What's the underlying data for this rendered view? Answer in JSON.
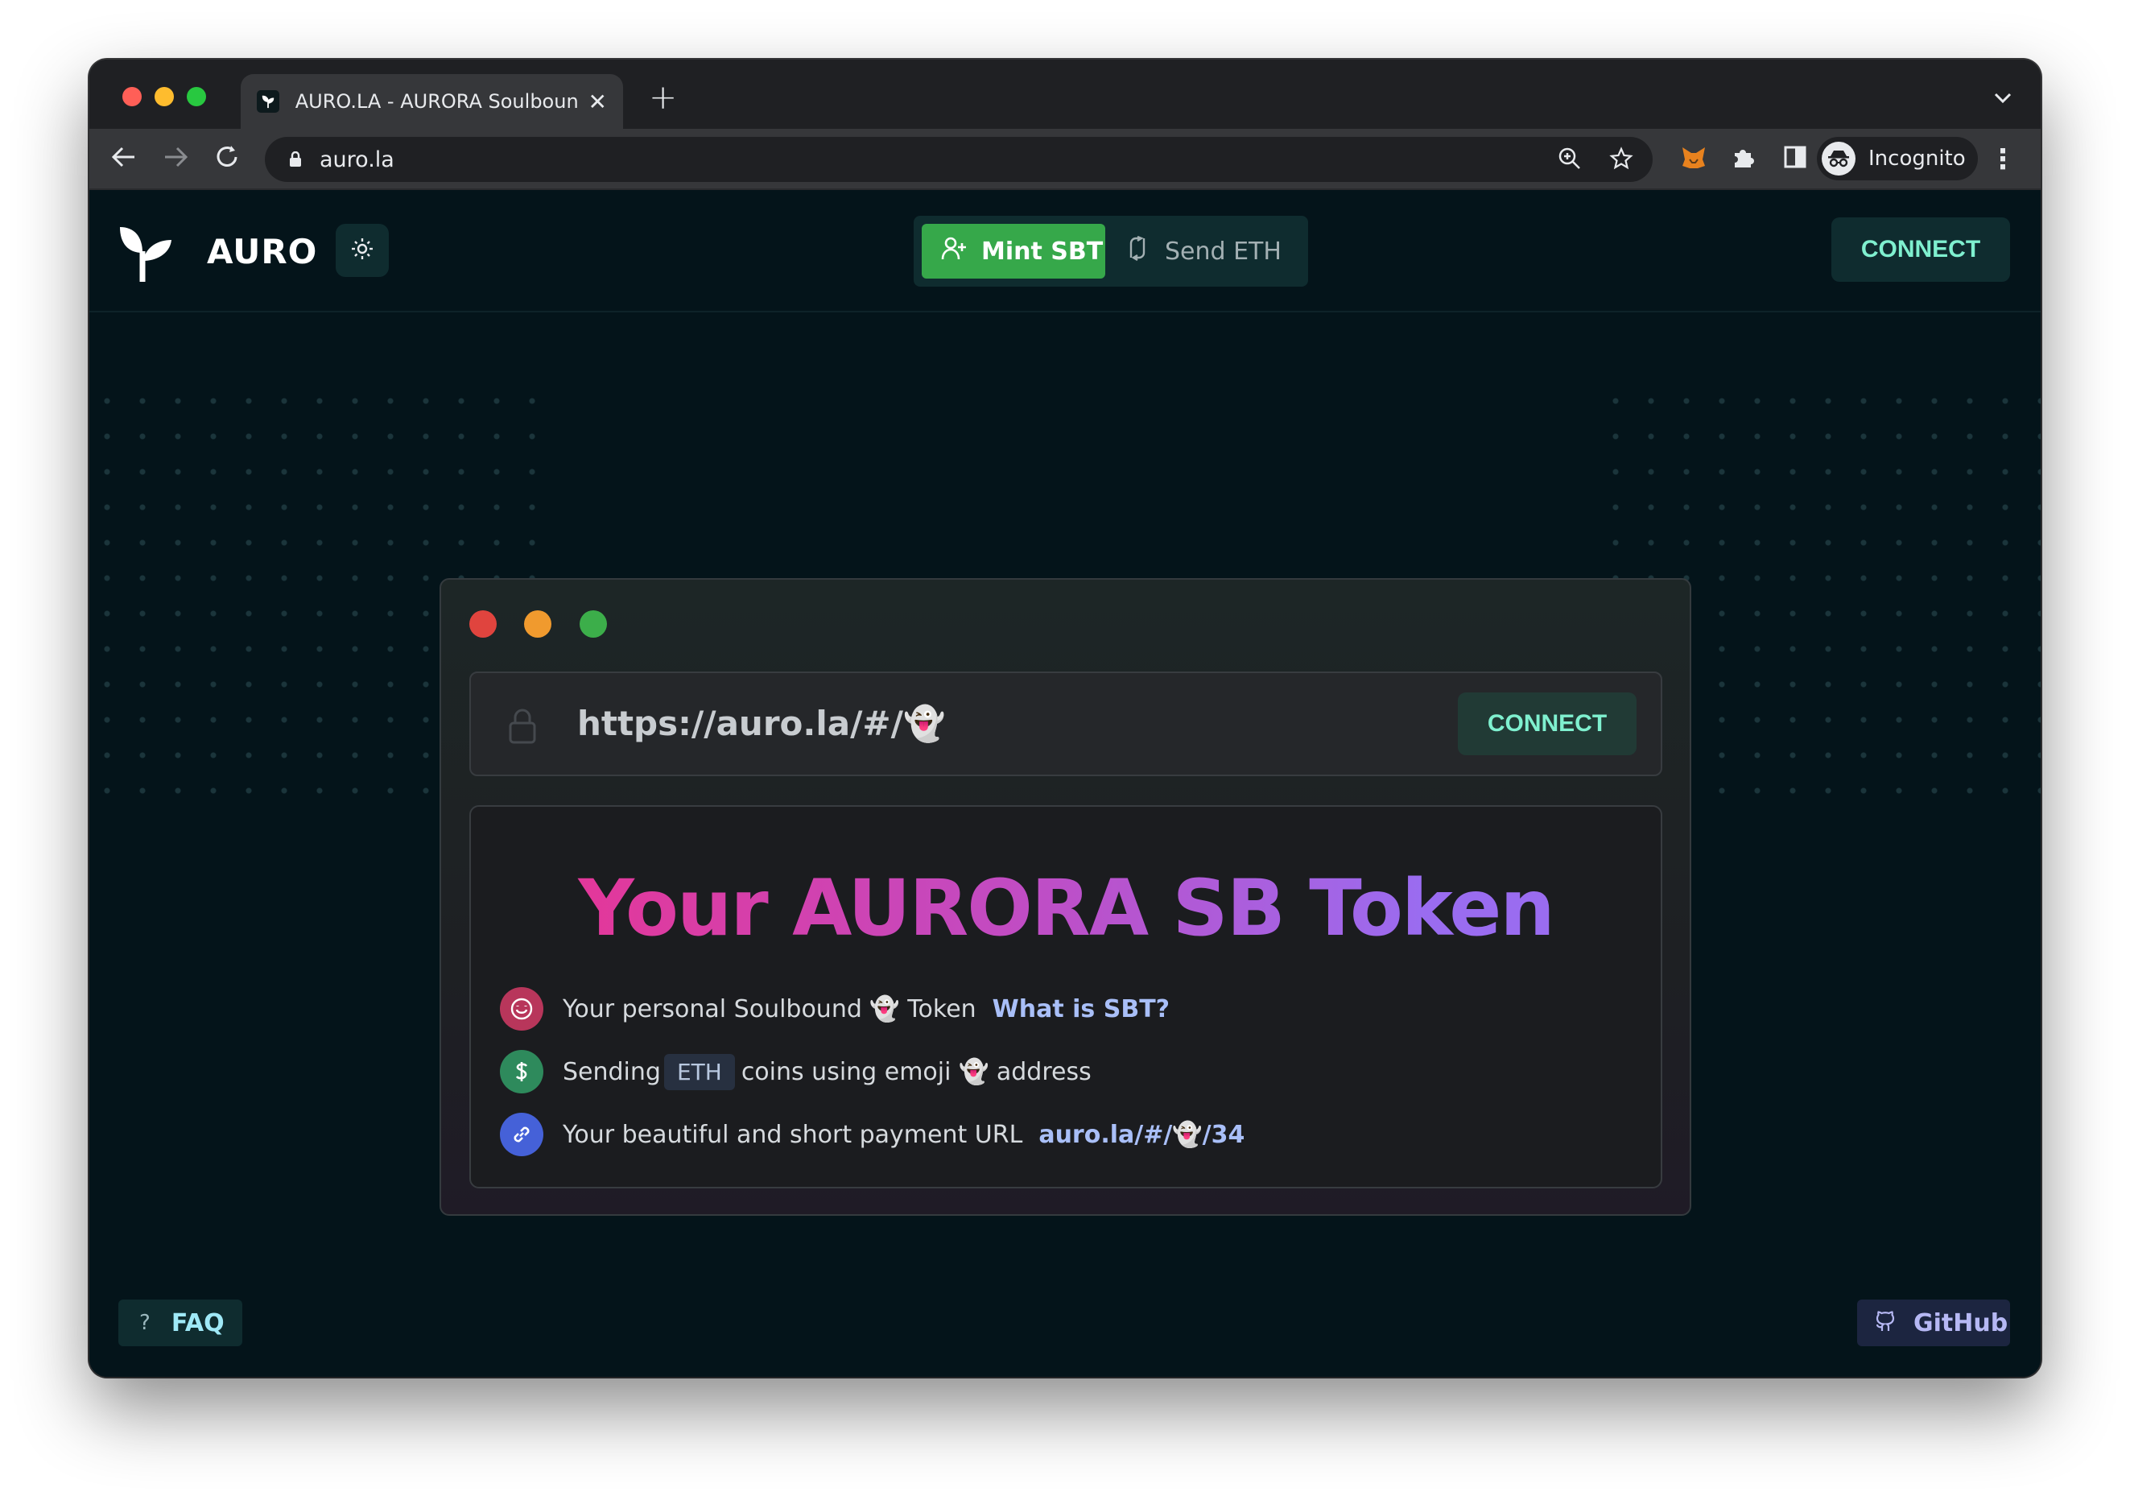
{
  "browser": {
    "tab_title": "AURO.LA - AURORA Soulbound",
    "url": "auro.la",
    "profile_label": "Incognito"
  },
  "header": {
    "brand": "AURO",
    "nav": {
      "mint_label": "Mint SBT",
      "send_label": "Send ETH"
    },
    "connect_label": "CONNECT"
  },
  "card": {
    "url_text": "https://auro.la/#/👻",
    "connect_label": "CONNECT",
    "headline": "Your AURORA SB Token",
    "features": [
      {
        "icon": "smile-icon",
        "text": "Your personal Soulbound 👻 Token",
        "link": "What is SBT?"
      },
      {
        "icon": "dollar-icon",
        "text_before": "Sending",
        "chip": "ETH",
        "text_after": "coins using emoji 👻 address"
      },
      {
        "icon": "link-icon",
        "text": "Your beautiful and short payment URL",
        "link": "auro.la/#/👻/34"
      }
    ]
  },
  "footer": {
    "faq_label": "FAQ",
    "github_label": "GitHub"
  },
  "colors": {
    "page_bg": "#04141a",
    "accent_green": "#36a84a",
    "connect_text": "#7ff0cf",
    "headline_start": "#e2389b",
    "headline_end": "#9a6cf0",
    "link_blue": "#a9bff8"
  }
}
